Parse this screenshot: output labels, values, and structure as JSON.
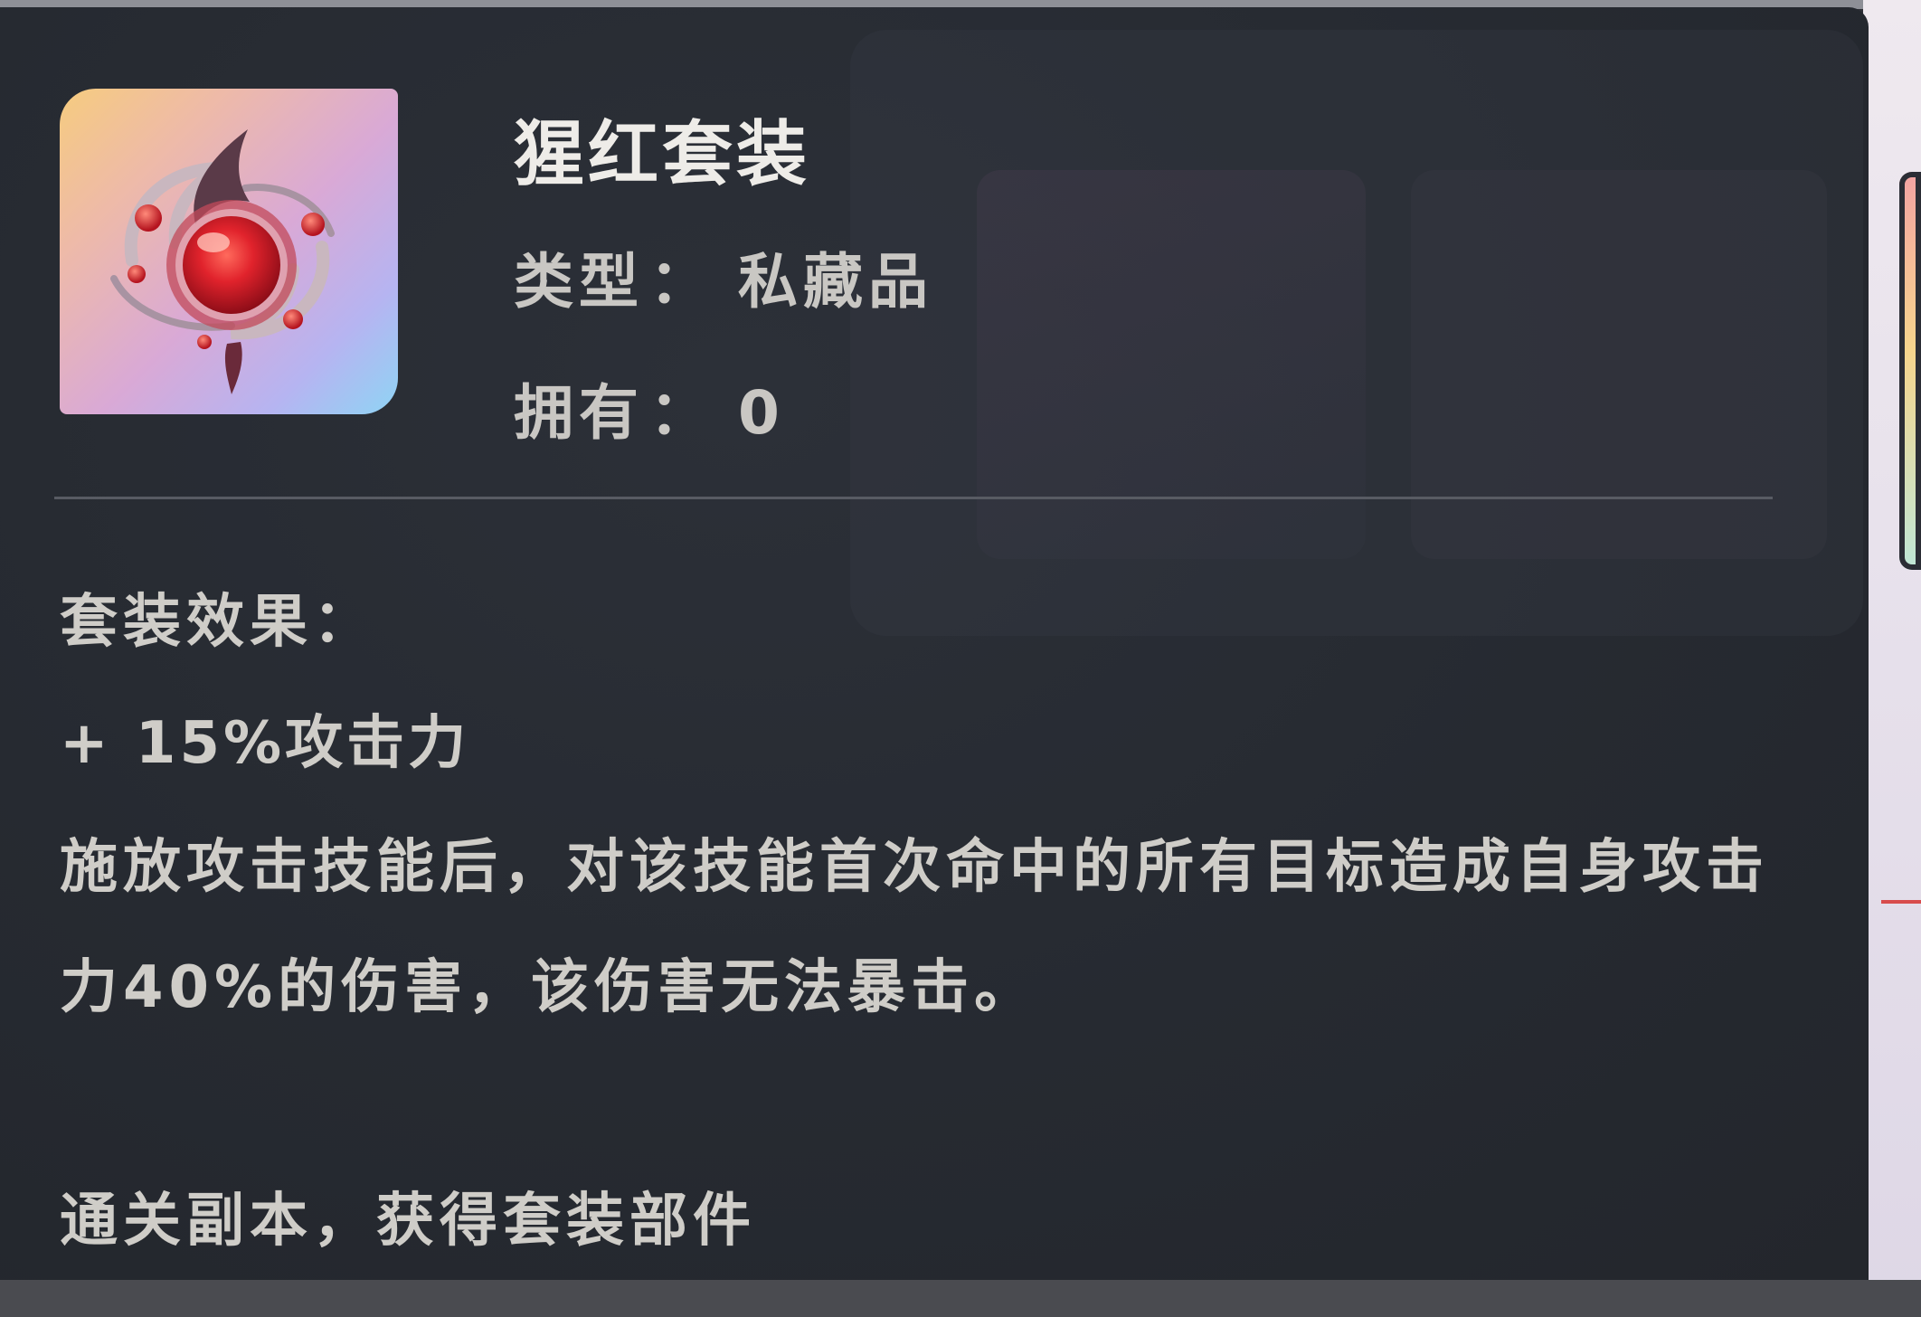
{
  "item": {
    "name": "猩红套装",
    "icon": "scarlet-gem-emblem-icon",
    "type_label": "类型",
    "type_value": "私藏品",
    "owned_label": "拥有",
    "owned_value": "0",
    "separator": "："
  },
  "set_effect": {
    "heading": "套装效果：",
    "stat": "+ 15%攻击力",
    "description": "施放攻击技能后，对该技能首次命中的所有目标造成自身攻击力40%的伤害，该伤害无法暴击。"
  },
  "footer": {
    "acquire_hint": "通关副本，获得套装部件"
  },
  "colors": {
    "panel_bg": "#262a31",
    "text_primary": "#eeece8",
    "text_secondary": "#cfcdc8",
    "gem_red": "#d8232b"
  }
}
